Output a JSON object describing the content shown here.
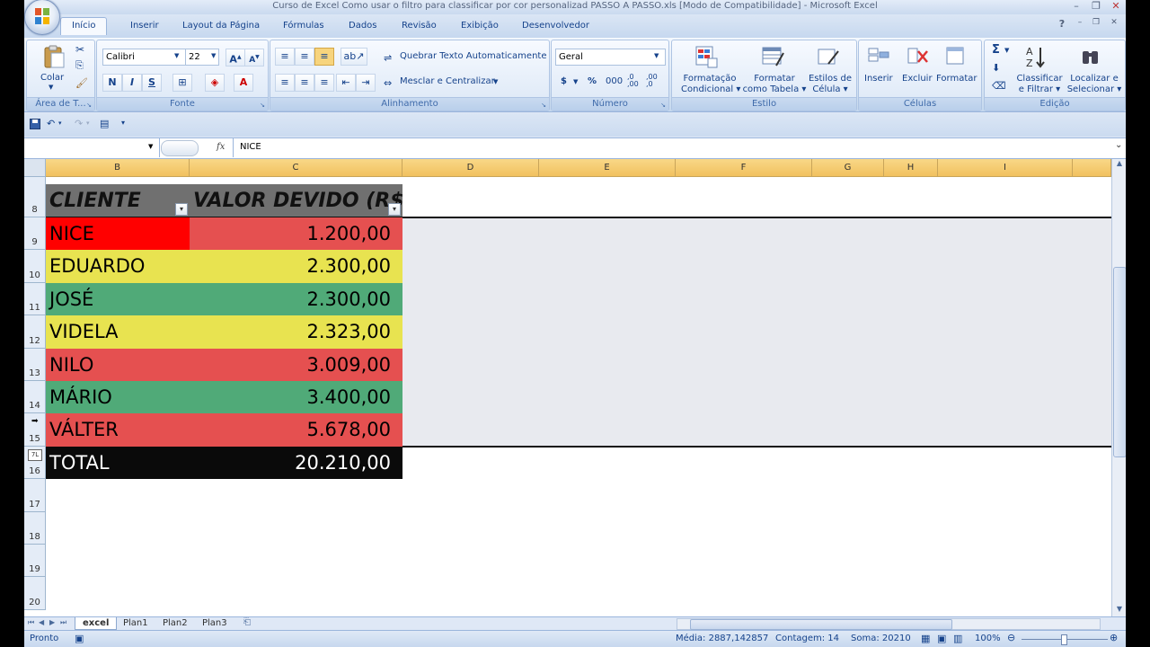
{
  "window": {
    "title": "Curso de Excel Como usar o filtro para classificar por cor personalizad PASSO A PASSO.xls  [Modo de Compatibilidade] - Microsoft Excel",
    "help": "?",
    "minimize": "–",
    "restore": "❐",
    "close": "✕"
  },
  "tabs": [
    "Início",
    "Inserir",
    "Layout da Página",
    "Fórmulas",
    "Dados",
    "Revisão",
    "Exibição",
    "Desenvolvedor"
  ],
  "ribbon": {
    "clipboard": {
      "label": "Área de T...",
      "paste": "Colar"
    },
    "font": {
      "label": "Fonte",
      "name": "Calibri",
      "size": "22",
      "bold": "N",
      "italic": "I",
      "underline": "S"
    },
    "alignment": {
      "label": "Alinhamento",
      "wrap": "Quebrar Texto Automaticamente",
      "merge": "Mesclar e Centralizar"
    },
    "number": {
      "label": "Número",
      "format": "Geral",
      "currency": "$",
      "percent": "%",
      "thousands": "000"
    },
    "styles": {
      "label": "Estilo",
      "cond_line1": "Formatação",
      "cond_line2": "Condicional",
      "table_line1": "Formatar",
      "table_line2": "como Tabela",
      "cell_line1": "Estilos de",
      "cell_line2": "Célula"
    },
    "cells": {
      "label": "Células",
      "insert": "Inserir",
      "delete": "Excluir",
      "format": "Formatar"
    },
    "editing": {
      "label": "Edição",
      "sort_line1": "Classificar",
      "sort_line2": "e Filtrar",
      "find_line1": "Localizar e",
      "find_line2": "Selecionar",
      "sum": "Σ"
    }
  },
  "formula_bar": {
    "fx": "fx",
    "value": "NICE"
  },
  "columns": [
    {
      "label": "B",
      "width": 160
    },
    {
      "label": "C",
      "width": 237
    },
    {
      "label": "D",
      "width": 152
    },
    {
      "label": "E",
      "width": 152
    },
    {
      "label": "F",
      "width": 152
    },
    {
      "label": "G",
      "width": 80
    },
    {
      "label": "H",
      "width": 60
    },
    {
      "label": "I",
      "width": 150
    }
  ],
  "table": {
    "headers": [
      "CLIENTE",
      "VALOR DEVIDO (R$)"
    ],
    "rows": [
      {
        "row": "9",
        "name": "NICE",
        "value": "1.200,00",
        "color": "#ff0000",
        "valueColor": "#e55050"
      },
      {
        "row": "10",
        "name": "EDUARDO",
        "value": "2.300,00",
        "color": "#e8e350",
        "valueColor": "#e8e350"
      },
      {
        "row": "11",
        "name": "JOSÉ",
        "value": "2.300,00",
        "color": "#50aa78",
        "valueColor": "#50aa78"
      },
      {
        "row": "12",
        "name": "VIDELA",
        "value": "2.323,00",
        "color": "#e8e350",
        "valueColor": "#e8e350"
      },
      {
        "row": "13",
        "name": "NILO",
        "value": "3.009,00",
        "color": "#e55050",
        "valueColor": "#e55050"
      },
      {
        "row": "14",
        "name": "MÁRIO",
        "value": "3.400,00",
        "color": "#50aa78",
        "valueColor": "#50aa78"
      },
      {
        "row": "15",
        "name": "VÁLTER",
        "value": "5.678,00",
        "color": "#e55050",
        "valueColor": "#e55050"
      }
    ],
    "total": {
      "row": "16",
      "name": "TOTAL",
      "value": "20.210,00"
    }
  },
  "row_labels": {
    "header": "8",
    "empty": [
      "17",
      "18",
      "19",
      "20"
    ],
    "filter_badge": "7L"
  },
  "sheets": [
    "excel",
    "Plan1",
    "Plan2",
    "Plan3"
  ],
  "status": {
    "ready": "Pronto",
    "average": "Média: 2887,142857",
    "count": "Contagem: 14",
    "sum": "Soma: 20210",
    "zoom": "100%"
  }
}
